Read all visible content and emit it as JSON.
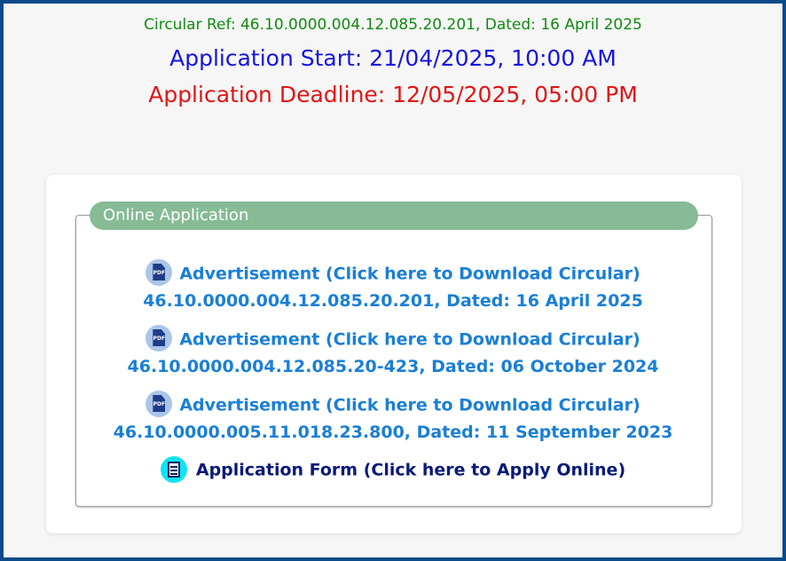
{
  "header": {
    "circular_ref": "Circular Ref: 46.10.0000.004.12.085.20.201, Dated: 16 April 2025",
    "application_start": "Application Start: 21/04/2025, 10:00 AM",
    "application_deadline": "Application Deadline: 12/05/2025, 05:00 PM"
  },
  "panel": {
    "legend": "Online Application",
    "items": [
      {
        "label": "Advertisement (Click here to Download Circular)",
        "detail": "46.10.0000.004.12.085.20.201, Dated: 16 April 2025",
        "icon": "pdf-icon",
        "icon_text": "PDF"
      },
      {
        "label": "Advertisement (Click here to Download Circular)",
        "detail": "46.10.0000.004.12.085.20-423, Dated: 06 October 2024",
        "icon": "pdf-icon",
        "icon_text": "PDF"
      },
      {
        "label": "Advertisement (Click here to Download Circular)",
        "detail": "46.10.0000.005.11.018.23.800, Dated: 11 September 2023",
        "icon": "pdf-icon",
        "icon_text": "PDF"
      }
    ],
    "application_form": {
      "label": "Application Form (Click here to Apply Online)",
      "icon": "form-icon"
    }
  },
  "colors": {
    "frame_border": "#0b4a8b",
    "ref_text": "#118a11",
    "start_text": "#1515e0",
    "deadline_text": "#e01515",
    "legend_bg": "#86bb96",
    "link_text": "#1a7fd6",
    "form_link_text": "#0a1a7a",
    "form_icon_bg": "#0fe3f2"
  }
}
